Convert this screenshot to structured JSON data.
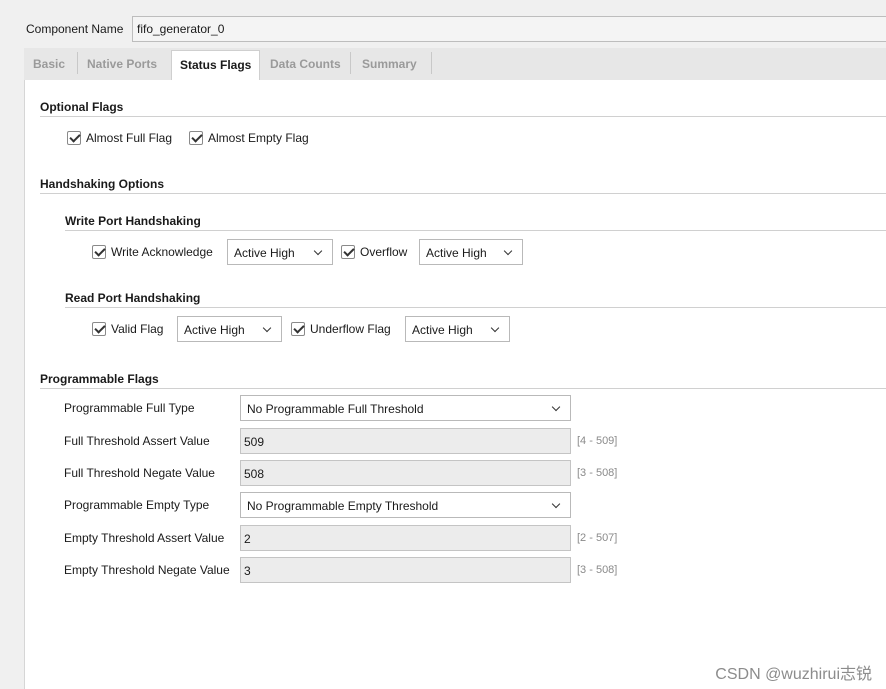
{
  "component": {
    "label": "Component Name",
    "value": "fifo_generator_0"
  },
  "tabs": [
    {
      "label": "Basic"
    },
    {
      "label": "Native Ports"
    },
    {
      "label": "Status Flags"
    },
    {
      "label": "Data Counts"
    },
    {
      "label": "Summary"
    }
  ],
  "active_tab": "Status Flags",
  "optional_flags": {
    "title": "Optional Flags",
    "almost_full": {
      "label": "Almost Full Flag",
      "checked": true
    },
    "almost_empty": {
      "label": "Almost Empty Flag",
      "checked": true
    }
  },
  "handshaking": {
    "title": "Handshaking Options",
    "write": {
      "title": "Write Port Handshaking",
      "ack": {
        "label": "Write Acknowledge",
        "checked": true,
        "value": "Active High"
      },
      "overflow": {
        "label": "Overflow",
        "checked": true,
        "value": "Active High"
      }
    },
    "read": {
      "title": "Read Port Handshaking",
      "valid": {
        "label": "Valid Flag",
        "checked": true,
        "value": "Active High"
      },
      "underflow": {
        "label": "Underflow Flag",
        "checked": true,
        "value": "Active High"
      }
    }
  },
  "programmable": {
    "title": "Programmable Flags",
    "full_type": {
      "label": "Programmable Full Type",
      "value": "No Programmable Full Threshold"
    },
    "full_assert": {
      "label": "Full Threshold Assert Value",
      "value": "509",
      "range": "[4 - 509]"
    },
    "full_negate": {
      "label": "Full Threshold Negate Value",
      "value": "508",
      "range": "[3 - 508]"
    },
    "empty_type": {
      "label": "Programmable Empty Type",
      "value": "No Programmable Empty Threshold"
    },
    "empty_assert": {
      "label": "Empty Threshold Assert Value",
      "value": "2",
      "range": "[2 - 507]"
    },
    "empty_negate": {
      "label": "Empty Threshold Negate Value",
      "value": "3",
      "range": "[3 - 508]"
    }
  },
  "watermark": "CSDN @wuzhirui志锐"
}
